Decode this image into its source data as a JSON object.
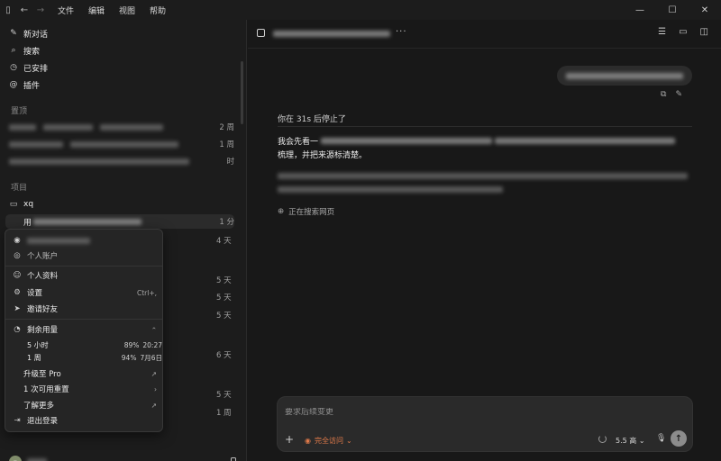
{
  "titlebar": {
    "menus": [
      "文件",
      "编辑",
      "视图",
      "帮助"
    ]
  },
  "sidebar": {
    "nav": [
      {
        "label": "新对话",
        "icon": "edit-icon"
      },
      {
        "label": "搜索",
        "icon": "search-icon"
      },
      {
        "label": "已安排",
        "icon": "clock-icon"
      },
      {
        "label": "插件",
        "icon": "plugin-icon"
      }
    ],
    "pinned_title": "置顶",
    "pinned": [
      {
        "meta": "2 周"
      },
      {
        "meta": "1 周"
      },
      {
        "meta": "时"
      }
    ],
    "projects_title": "项目",
    "project_name": "xq",
    "active_thread": {
      "prefix": "用",
      "meta": "1 分"
    },
    "thread_metas": [
      "4 天",
      "5 天",
      "5 天",
      "5 天",
      "6 天",
      "5 天",
      "1 周"
    ]
  },
  "popup": {
    "personal_account": "个人账户",
    "profile": "个人资料",
    "settings": "设置",
    "settings_shortcut": "Ctrl+,",
    "invite": "邀请好友",
    "remaining": "剩余用量",
    "usage": [
      {
        "name": "5 小时",
        "pct": "89%",
        "time": "20:27"
      },
      {
        "name": "1 周",
        "pct": "94%",
        "time": "7月6日"
      }
    ],
    "upgrade": "升级至 Pro",
    "reset": "1 次可用重置",
    "learn_more": "了解更多",
    "logout": "退出登录"
  },
  "main": {
    "stopped": "你在 31s 后停止了",
    "para1_tail": "梳理，并把来源标清楚。",
    "para1_head": "我会先看一",
    "searching": "正在搜索网页",
    "composer_placeholder": "要求后续变更",
    "access_label": "完全访问",
    "model_label": "5.5 高"
  },
  "colors": {
    "background": "#181818",
    "sidebar": "#1c1c1c",
    "accent_orange": "#e07a4a"
  }
}
